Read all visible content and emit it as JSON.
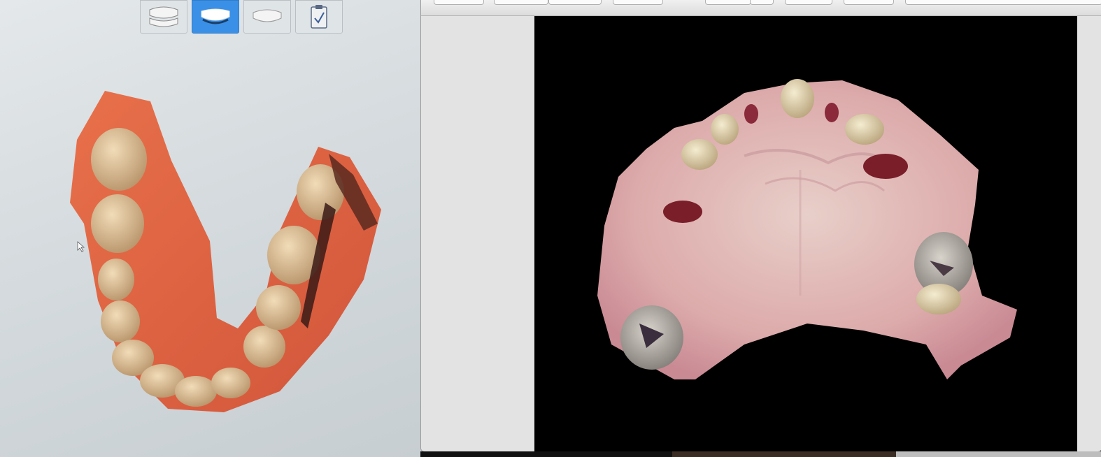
{
  "left_screen": {
    "description_icons": [
      "full-arch-icon",
      "lower-jaw-icon",
      "upper-jaw-icon",
      "checklist-icon"
    ],
    "active_step": 1
  },
  "window": {
    "toolbar_buttons": 10
  },
  "colors": {
    "accent": "#3a90e6",
    "gum": "#e07a58",
    "palate": "#e2b4b4"
  }
}
